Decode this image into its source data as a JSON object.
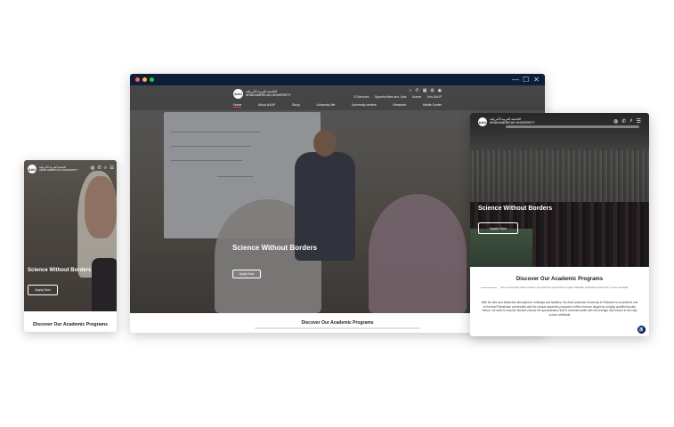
{
  "brand": {
    "logo_mark": "AAU",
    "logo_arabic": "الجامعة العربية الأمريكية",
    "logo_english": "ARAB AMERICAN UNIVERSITY"
  },
  "desktop": {
    "window_controls": [
      "—",
      "☐",
      "✕"
    ],
    "top_links": [
      "E-Services",
      "Opportunities and Jobs",
      "Alumni",
      "Join AAUP"
    ],
    "menu": [
      "Home",
      "About AAUP",
      "Study",
      "University life",
      "University centers",
      "Research",
      "Media Center"
    ],
    "hero_title": "Science Without Borders",
    "apply_label": "Apply Now",
    "section_title": "Discover Our Academic Programs"
  },
  "tablet": {
    "hero_title": "Science Without Borders",
    "apply_label": "Apply Now",
    "section_title": "Discover Our Academic Programs",
    "section_subtitle": "Join a university that provides you with the opportunity to gain valuable practical experience in your specialty",
    "section_paragraph": "With its calm and distinctive atmosphere, buildings and facilities, the Arab American University in Palestine is considered one of the best Palestinian universities with the unique academic programs it offers that are taught by a highly qualified faculty. Hence, we seek to help the student choose the specialization that is commensurate with his average and branch in the high school certificate"
  },
  "phone": {
    "hero_title": "Science Without Borders",
    "apply_label": "Apply Now",
    "section_title": "Discover Our Academic Programs"
  },
  "colors": {
    "titlebar": "#0d1d3a",
    "accent_red": "#e33333",
    "overlay_text": "#ffffff"
  },
  "icons": [
    "search-icon",
    "phone-icon",
    "grid-icon",
    "translate-icon",
    "user-icon",
    "accessibility-icon",
    "menu-icon"
  ]
}
